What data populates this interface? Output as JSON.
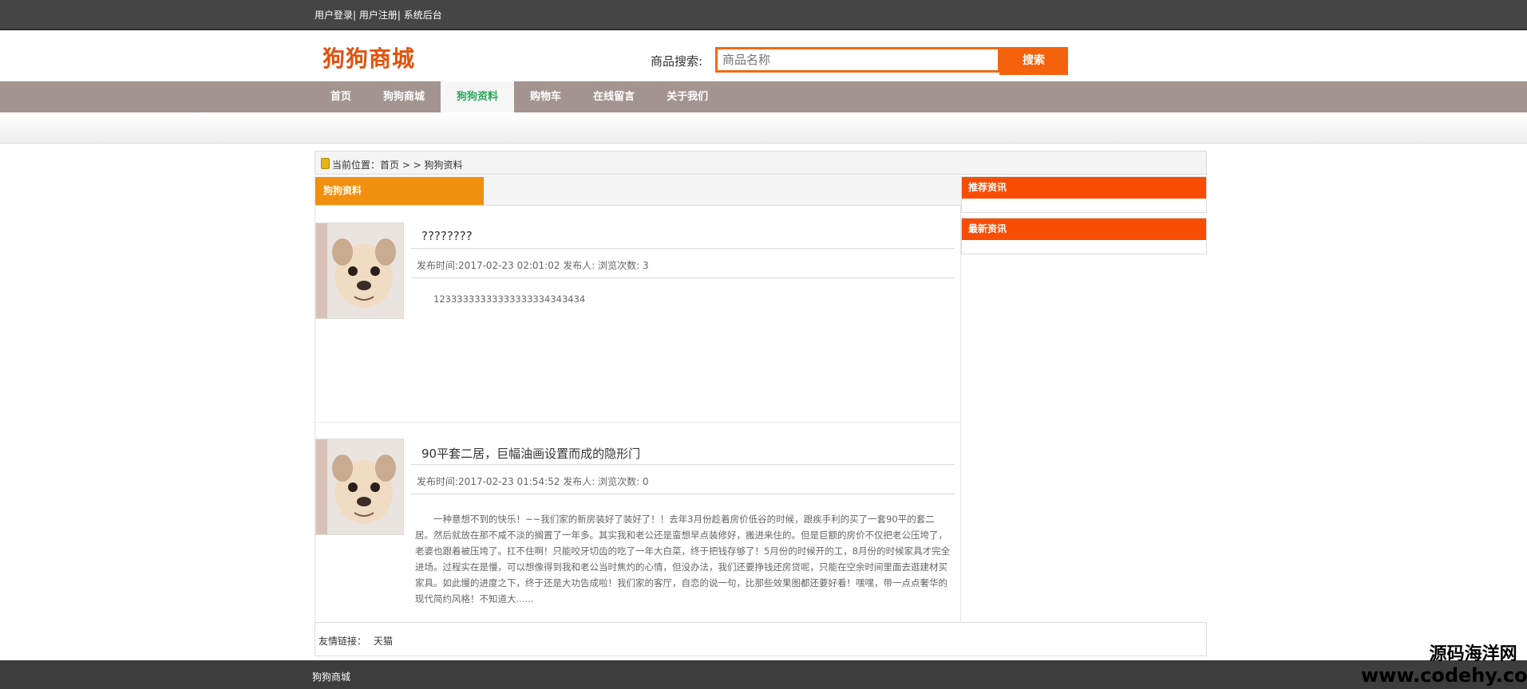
{
  "topbar": {
    "links": [
      "用户登录",
      "用户注册",
      "系统后台"
    ],
    "separator": "|"
  },
  "header": {
    "logo": "狗狗商城",
    "search_label": "商品搜索:",
    "search_placeholder": "商品名称",
    "search_button": "搜索"
  },
  "nav": {
    "items": [
      "首页",
      "狗狗商城",
      "狗狗资料",
      "购物车",
      "在线留言",
      "关于我们"
    ],
    "active": "狗狗资料"
  },
  "breadcrumb": {
    "text": "当前位置：首页 > > 狗狗资料"
  },
  "main": {
    "section_title": "狗狗资料"
  },
  "articles": [
    {
      "title": "????????",
      "meta": "发布时间:2017-02-23 02:01:02 发布人: 浏览次数: 3",
      "body": "12333333333333333334343434"
    },
    {
      "title": "90平套二居，巨幅油画设置而成的隐形门",
      "meta": "发布时间:2017-02-23 01:54:52 发布人: 浏览次数: 0",
      "body": "一种意想不到的快乐！~~我们家的新房装好了装好了！！去年3月份趁着房价低谷的时候，跟疾手利的买了一套90平的套二居。然后就放在那不咸不淡的搁置了一年多。其实我和老公还是蛮想早点装修好，搬进来住的。但是巨额的房价不仅把老公压垮了，老婆也跟着被压垮了。扛不住啊！只能咬牙切齿的吃了一年大白菜，终于把钱存够了！5月份的时候开的工，8月份的时候家具才完全进场。过程实在是慢，可以想像得到我和老公当时焦灼的心情，但没办法，我们还要挣钱还房贷呢，只能在空余时间里面去逛建材买家具。如此慢的进度之下，终于还是大功告成啦！我们家的客厅，自恋的说一句，比那些效果图都还要好看！嘿嘿，带一点点奢华的现代简约风格！不知道大......"
    }
  ],
  "sidebar": {
    "recommended_title": "推荐资讯",
    "latest_title": "最新资讯"
  },
  "friends": {
    "label": "友情链接：",
    "items": [
      "天猫"
    ]
  },
  "footer": {
    "text": "狗狗商城"
  },
  "watermark": {
    "line1": "源码海洋网",
    "line2": "www.codehy.com"
  },
  "colors": {
    "brand": "#e2520f",
    "nav_bg": "#a39492",
    "active_tab_text": "#2aa65b",
    "section_orange": "#f18f0e",
    "sidebar_header": "#f94d04"
  }
}
